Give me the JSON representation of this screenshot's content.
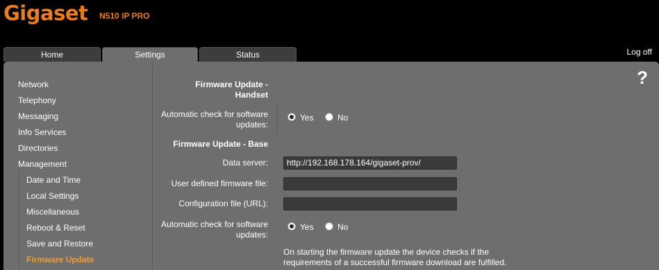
{
  "header": {
    "logo": "Gigaset",
    "model": "N510 IP PRO"
  },
  "tabs": [
    {
      "label": "Home"
    },
    {
      "label": "Settings"
    },
    {
      "label": "Status"
    }
  ],
  "logoff": "Log off",
  "help": "?",
  "sidebar": {
    "items": [
      {
        "label": "Network"
      },
      {
        "label": "Telephony"
      },
      {
        "label": "Messaging"
      },
      {
        "label": "Info Services"
      },
      {
        "label": "Directories"
      },
      {
        "label": "Management"
      },
      {
        "label": "Date and Time"
      },
      {
        "label": "Local Settings"
      },
      {
        "label": "Miscellaneous"
      },
      {
        "label": "Reboot & Reset"
      },
      {
        "label": "Save and Restore"
      },
      {
        "label": "Firmware Update"
      }
    ]
  },
  "form": {
    "handset_heading": "Firmware Update - Handset",
    "handset_auto_check_label": "Automatic check for software updates:",
    "handset_auto_check": {
      "yes": "Yes",
      "no": "No",
      "selected": "Yes"
    },
    "base_heading": "Firmware Update - Base",
    "data_server_label": "Data server:",
    "data_server_value": "http://192.168.178.164/gigaset-prov/",
    "user_firmware_label": "User defined firmware file:",
    "user_firmware_value": "",
    "config_file_label": "Configuration file (URL):",
    "config_file_value": "",
    "base_auto_check_label": "Automatic check for software updates:",
    "base_auto_check": {
      "yes": "Yes",
      "no": "No",
      "selected": "Yes"
    },
    "note": "On starting the firmware update the device checks if the requirements of a successful firmware download are fulfilled."
  }
}
